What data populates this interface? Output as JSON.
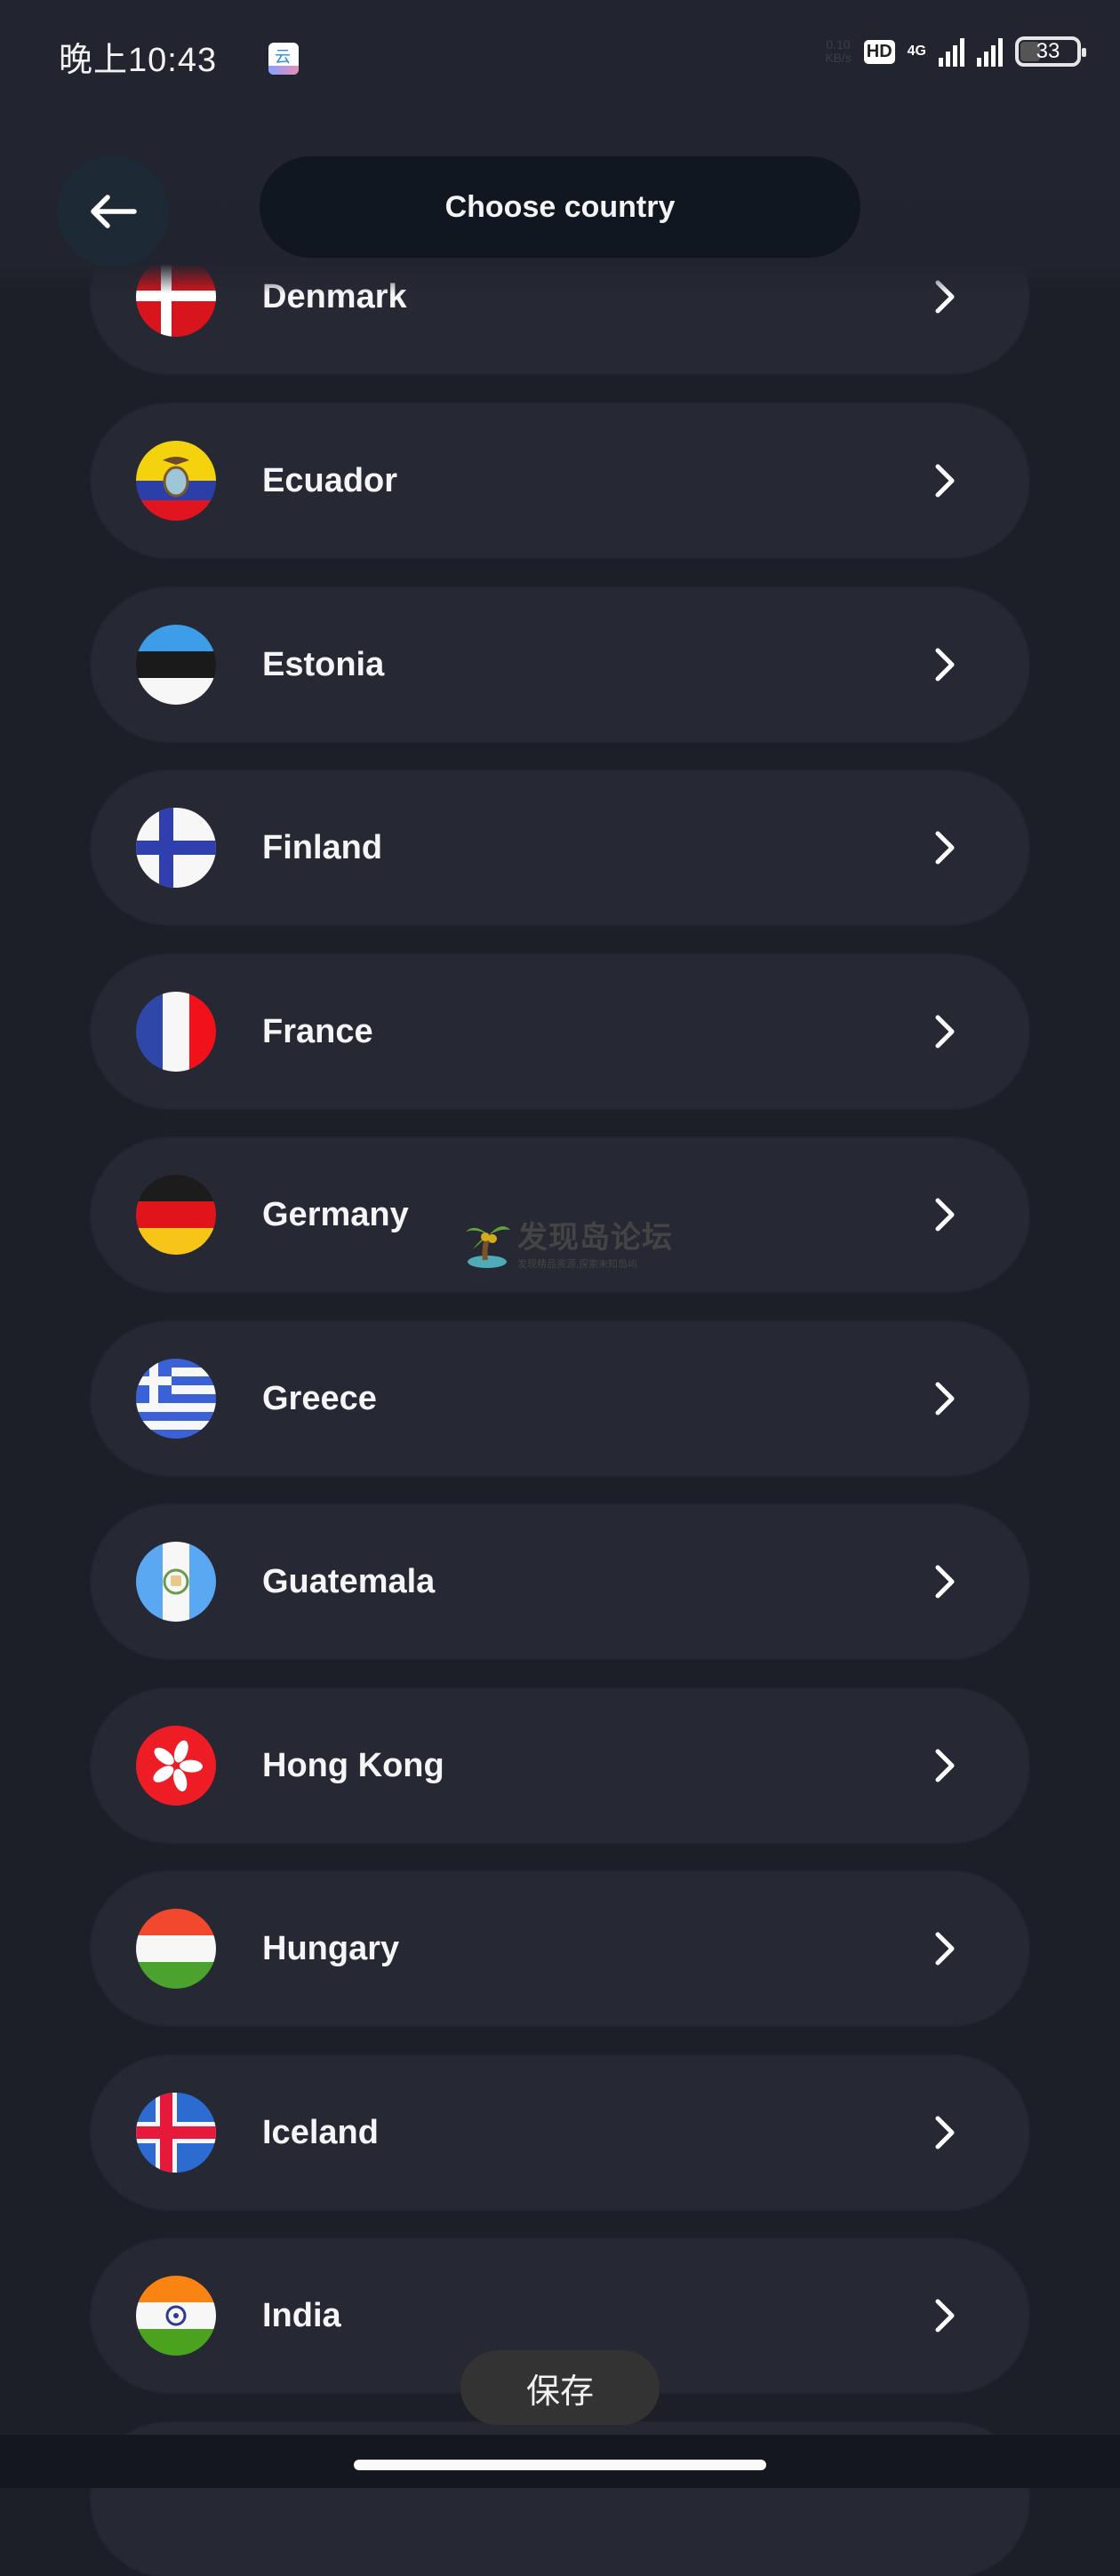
{
  "status_bar": {
    "time": "晚上10:43",
    "network_speed": "0.10",
    "network_speed_unit": "KB/s",
    "hd_badge": "HD",
    "network_type": "4G",
    "battery_level": "33",
    "notification_app_icon": "cloud-app-icon"
  },
  "header": {
    "back_icon": "arrow-left-icon",
    "title": "Choose country"
  },
  "countries": [
    {
      "name": "Denmark",
      "flag": "denmark-flag-icon"
    },
    {
      "name": "Ecuador",
      "flag": "ecuador-flag-icon"
    },
    {
      "name": "Estonia",
      "flag": "estonia-flag-icon"
    },
    {
      "name": "Finland",
      "flag": "finland-flag-icon"
    },
    {
      "name": "France",
      "flag": "france-flag-icon"
    },
    {
      "name": "Germany",
      "flag": "germany-flag-icon"
    },
    {
      "name": "Greece",
      "flag": "greece-flag-icon"
    },
    {
      "name": "Guatemala",
      "flag": "guatemala-flag-icon"
    },
    {
      "name": "Hong Kong",
      "flag": "hong-kong-flag-icon"
    },
    {
      "name": "Hungary",
      "flag": "hungary-flag-icon"
    },
    {
      "name": "Iceland",
      "flag": "iceland-flag-icon"
    },
    {
      "name": "India",
      "flag": "india-flag-icon"
    },
    {
      "name": "",
      "flag": ""
    }
  ],
  "row_chevron_icon": "chevron-right-icon",
  "watermark": {
    "title": "发现岛论坛",
    "subtitle": "发现精品资源,探索未知岛屿"
  },
  "toast": {
    "label": "保存"
  },
  "colors": {
    "background": "#1d1f28",
    "row_background": "#262833",
    "title_pill": "#111720",
    "back_button": "#1e2936",
    "text": "#f5f5f7"
  }
}
